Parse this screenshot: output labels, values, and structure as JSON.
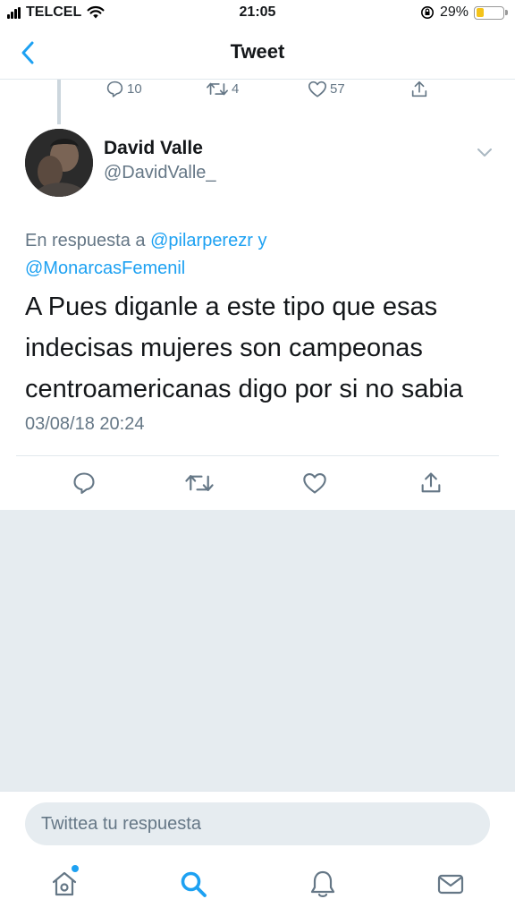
{
  "status_bar": {
    "carrier": "TELCEL",
    "time": "21:05",
    "battery": "29%"
  },
  "nav": {
    "title": "Tweet"
  },
  "prev_tweet": {
    "reply_count": "10",
    "retweet_count": "4",
    "like_count": "57"
  },
  "tweet": {
    "author_name": "David Valle",
    "author_handle": "@DavidValle_",
    "reply_prefix": "En respuesta a ",
    "mention_1": "@pilarperezr",
    "reply_joiner": " y",
    "mention_2": "@MonarcasFemenil",
    "text": "A Pues diganle a este tipo que esas indecisas mujeres son campeonas centroamericanas digo por si no sabia",
    "timestamp": "03/08/18 20:24"
  },
  "reply_bar": {
    "placeholder": "Twittea tu respuesta"
  },
  "tabs": [
    "home-icon",
    "search-icon",
    "notifications-icon",
    "messages-icon"
  ],
  "colors": {
    "accent": "#1da1f2",
    "secondary_text": "#657786",
    "background_gray": "#e6ecf0"
  }
}
